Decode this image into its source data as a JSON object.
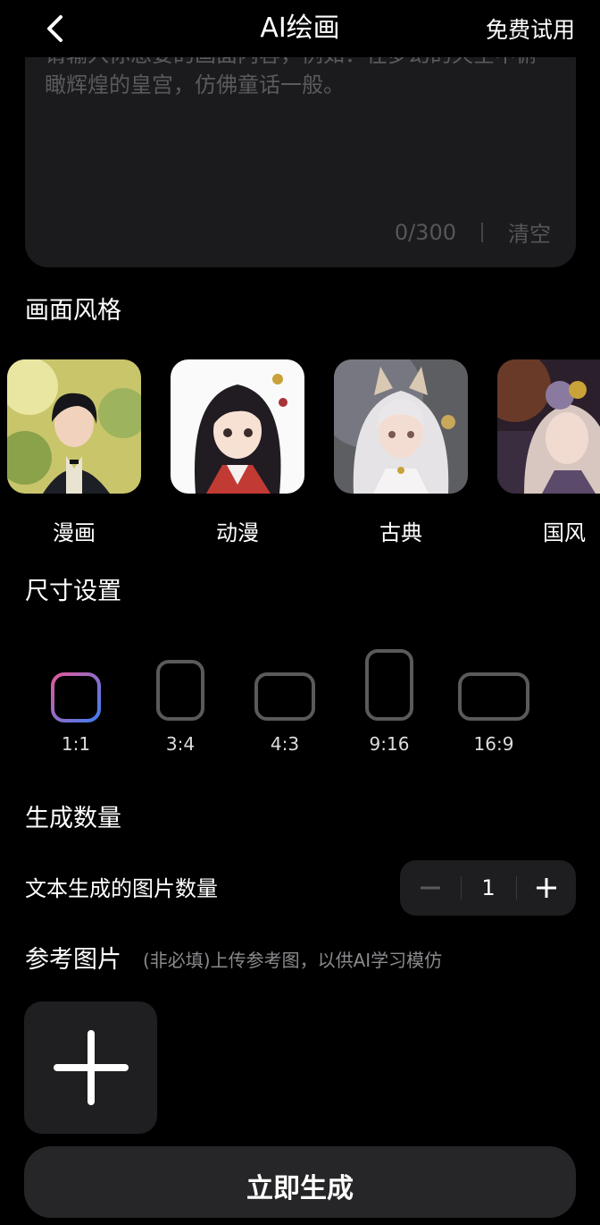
{
  "header": {
    "title": "AI绘画",
    "trial_label": "免费试用",
    "back_icon": "chevron-left-icon"
  },
  "prompt": {
    "placeholder": "请输入你想要的画面内容，例如：在梦幻的天空中俯瞰辉煌的皇宫，仿佛童话一般。",
    "counter": "0/300",
    "clear_label": "清空"
  },
  "styles": {
    "title": "画面风格",
    "items": [
      {
        "label": "漫画"
      },
      {
        "label": "动漫"
      },
      {
        "label": "古典"
      },
      {
        "label": "国风"
      }
    ]
  },
  "size": {
    "title": "尺寸设置",
    "selected": "1:1",
    "options": [
      {
        "label": "1:1"
      },
      {
        "label": "3:4"
      },
      {
        "label": "4:3"
      },
      {
        "label": "9:16"
      },
      {
        "label": "16:9"
      }
    ]
  },
  "quantity": {
    "title": "生成数量",
    "label": "文本生成的图片数量",
    "value": "1"
  },
  "reference": {
    "title": "参考图片",
    "hint": "(非必填)上传参考图，以供AI学习模仿",
    "upload_icon": "plus-icon"
  },
  "generate": {
    "label": "立即生成"
  },
  "colors": {
    "background": "#000000",
    "panel": "#1b1b1d",
    "selected_gradient_start": "#e25a9a",
    "selected_gradient_end": "#3f7df2"
  }
}
